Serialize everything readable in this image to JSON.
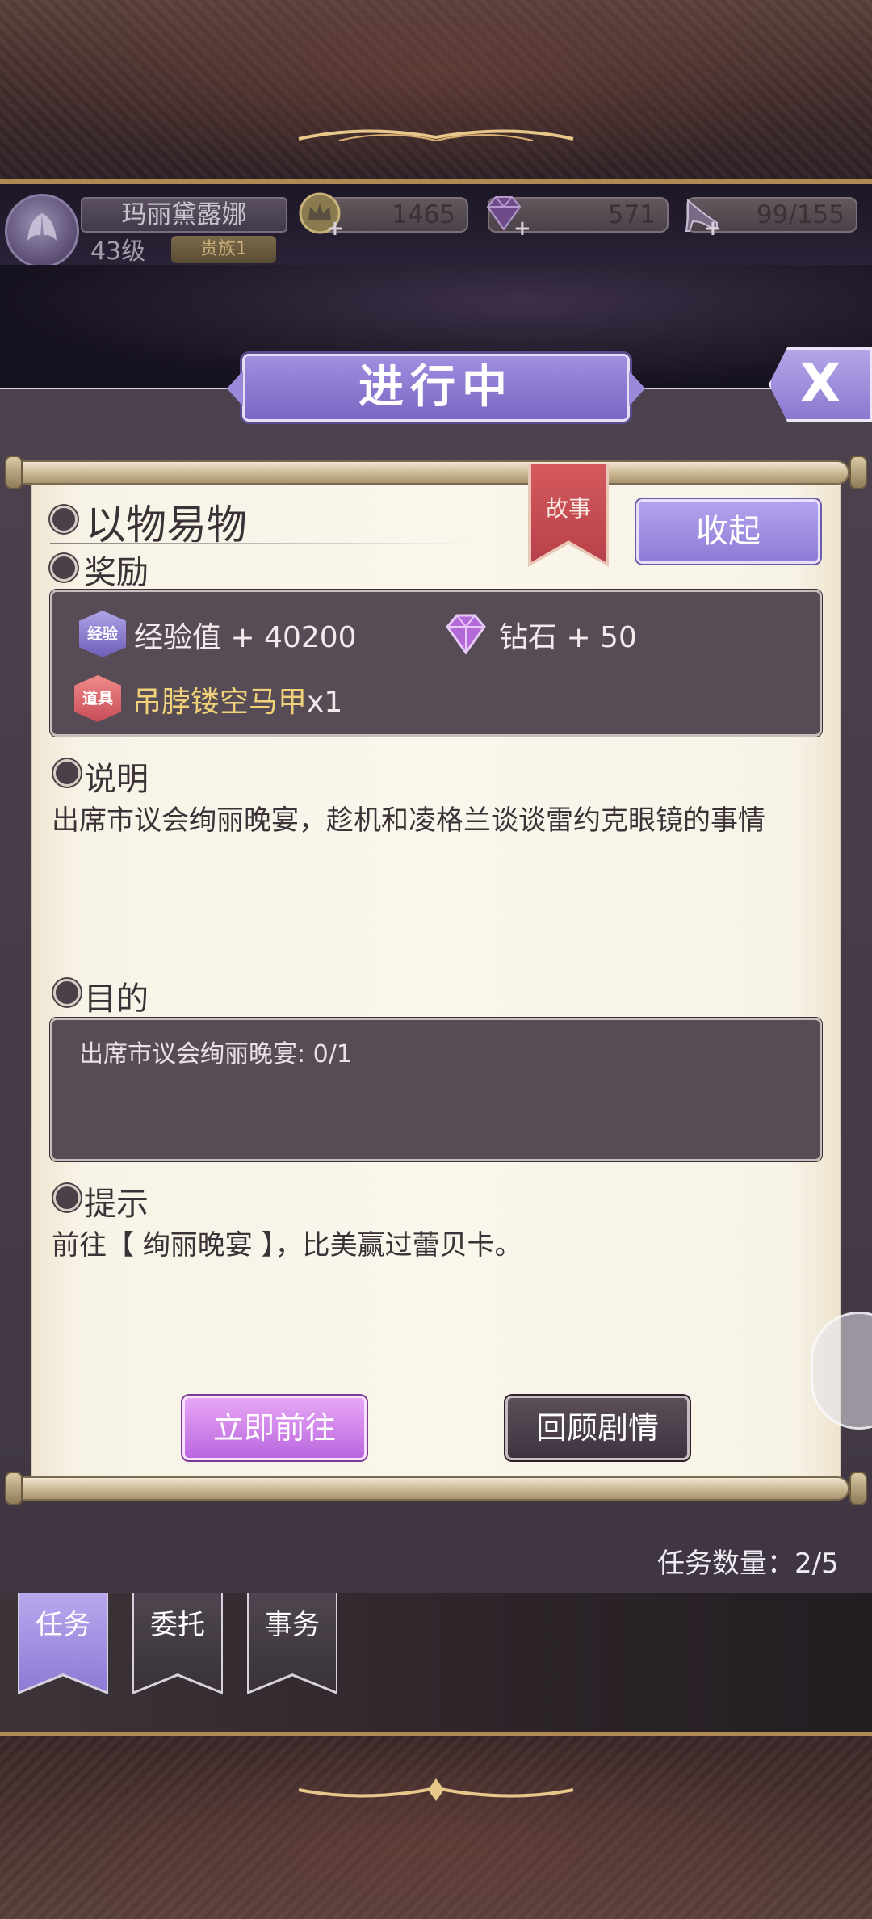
{
  "player": {
    "name": "玛丽黛露娜",
    "level": "43级",
    "title": "贵族1"
  },
  "currencies": {
    "gold": "1465",
    "diamond": "571",
    "stamina": "99/155"
  },
  "panel": {
    "title": "进行中",
    "close_label": "X"
  },
  "quest": {
    "title": "以物易物",
    "category": "故事",
    "collapse_label": "收起",
    "reward_heading": "奖励",
    "rewards": {
      "exp_badge": "经验",
      "exp_text": "经验值 + 40200",
      "diamond_text": "钻石 + 50",
      "item_badge": "道具",
      "item_name": "吊脖镂空马甲",
      "item_qty": "x1"
    },
    "desc_heading": "说明",
    "description": "出席市议会绚丽晚宴，趁机和凌格兰谈谈雷约克眼镜的事情",
    "goal_heading": "目的",
    "goal_text": "出席市议会绚丽晚宴: 0/1",
    "hint_heading": "提示",
    "hint_text": "前往【 绚丽晚宴 】，比美赢过蕾贝卡。",
    "go_button": "立即前往",
    "review_button": "回顾剧情"
  },
  "task_count": "任务数量：2/5",
  "tabs": [
    {
      "label": "任务",
      "active": true
    },
    {
      "label": "委托",
      "active": false
    },
    {
      "label": "事务",
      "active": false
    }
  ],
  "colors": {
    "accent_purple": "#8f7bd6",
    "go_button": "#b967de",
    "ribbon_red": "#c84c58",
    "item_gold": "#f0d27a"
  }
}
